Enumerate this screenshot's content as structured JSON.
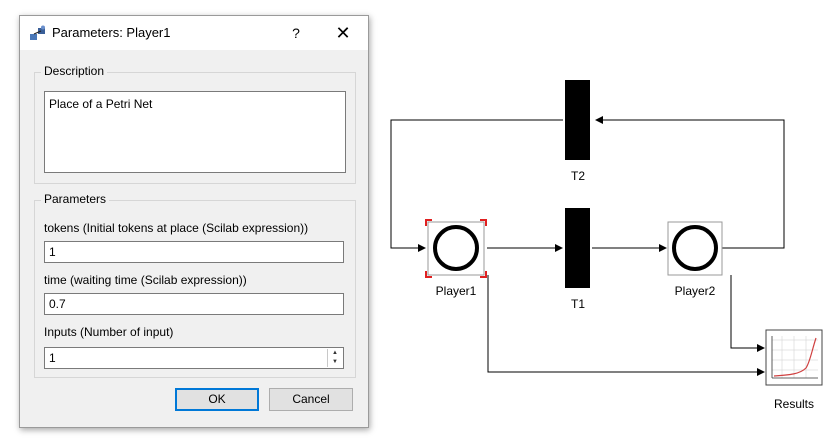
{
  "dialog": {
    "title": "Parameters: Player1",
    "help_glyph": "?",
    "close_glyph": "✕",
    "description_group": "Description",
    "description_text": "Place of a Petri Net",
    "parameters_group": "Parameters",
    "fields": [
      {
        "label": "tokens (Initial tokens at place  (Scilab expression))",
        "value": "1"
      },
      {
        "label": "time (waiting time  (Scilab expression))",
        "value": "0.7"
      },
      {
        "label": "Inputs (Number of input)",
        "value": "1"
      }
    ],
    "ok_label": "OK",
    "cancel_label": "Cancel"
  },
  "diagram": {
    "places": [
      "Player1",
      "Player2"
    ],
    "transitions": [
      "T1",
      "T2"
    ],
    "scope_label": "Results"
  },
  "colors": {
    "accent": "#0078d7",
    "selection_handle": "#e02020",
    "scope_curve": "#d04040"
  },
  "icons": [
    "app-icon",
    "help-icon",
    "close-icon",
    "spin-up-icon",
    "spin-down-icon",
    "scope-icon"
  ]
}
